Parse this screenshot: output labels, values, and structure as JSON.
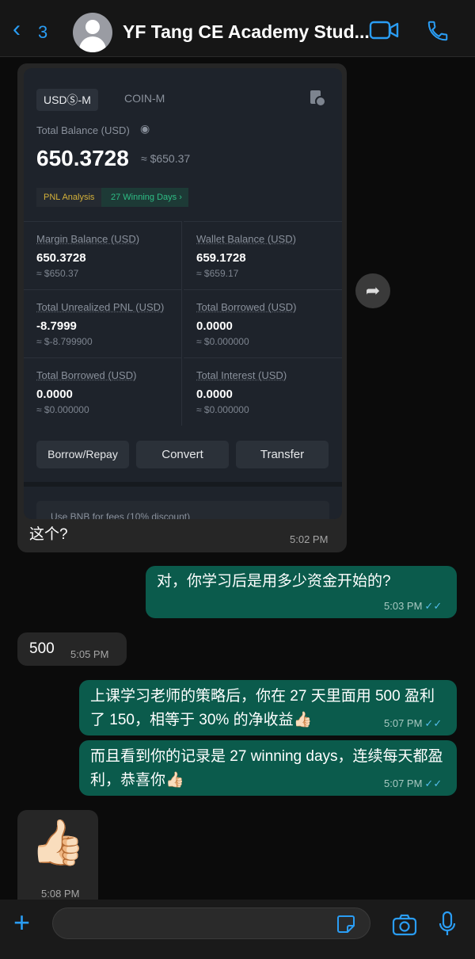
{
  "header": {
    "back_count": "3",
    "title": "YF Tang CE Academy Stud...",
    "icons": [
      "chevron-left-icon",
      "video-call-icon",
      "phone-icon"
    ],
    "accent": "#2a9df4"
  },
  "screenshot_card": {
    "tabs": [
      "USDⓈ-M",
      "COIN-M"
    ],
    "total_balance_label": "Total Balance (USD)",
    "total_balance": "650.3728",
    "total_balance_approx": "≈ $650.37",
    "pnl_label": "PNL Analysis",
    "winning_days": "27 Winning Days",
    "cells": [
      {
        "label": "Margin Balance (USD)",
        "value": "650.3728",
        "approx": "≈ $650.37"
      },
      {
        "label": "Wallet Balance (USD)",
        "value": "659.1728",
        "approx": "≈ $659.17"
      },
      {
        "label": "Total Unrealized PNL (USD)",
        "value": "-8.7999",
        "approx": "≈ $-8.799900"
      },
      {
        "label": "Total Borrowed (USD)",
        "value": "0.0000",
        "approx": "≈ $0.000000"
      },
      {
        "label": "Total Borrowed (USD)",
        "value": "0.0000",
        "approx": "≈ $0.000000"
      },
      {
        "label": "Total Interest (USD)",
        "value": "0.0000",
        "approx": "≈ $0.000000"
      }
    ],
    "buttons": [
      "Borrow/Repay",
      "Convert",
      "Transfer"
    ],
    "cut_text": "Use BNB for fees (10% discount)"
  },
  "messages": [
    {
      "dir": "in",
      "text": "这个?",
      "time": "5:02 PM"
    },
    {
      "dir": "out",
      "text": "对，你学习后是用多少资金开始的?",
      "time": "5:03 PM"
    },
    {
      "dir": "in",
      "text": "500",
      "time": "5:05 PM"
    },
    {
      "dir": "out",
      "text": "上课学习老师的策略后，你在 27 天里面用 500 盈利了 150，相等于 30% 的净收益👍🏻",
      "time": "5:07 PM"
    },
    {
      "dir": "out",
      "text": "而且看到你的记录是 27 winning days，连续每天都盈利，恭喜你👍🏻",
      "time": "5:07 PM"
    },
    {
      "dir": "in",
      "sticker": "👍🏻",
      "time": "5:08 PM"
    }
  ],
  "read_ticks": "✓✓",
  "composer": {
    "icons": [
      "plus-icon",
      "sticker-icon",
      "camera-icon",
      "microphone-icon"
    ]
  }
}
